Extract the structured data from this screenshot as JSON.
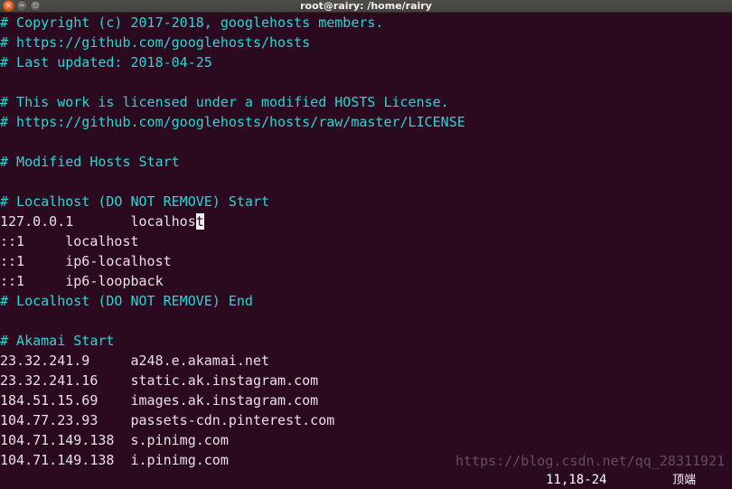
{
  "window": {
    "title": "root@rairy: /home/rairy",
    "controls": [
      {
        "name": "close",
        "glyph": "×"
      },
      {
        "name": "minimize",
        "glyph": "−"
      },
      {
        "name": "maximize",
        "glyph": "□"
      }
    ]
  },
  "colors": {
    "background": "#2b0a1f",
    "comment": "#2ad5d5",
    "text": "#e8e0e8",
    "titlebar": "#484844",
    "cursor": "#f4f0f4",
    "watermark": "#6e5a68"
  },
  "editor": {
    "lines": [
      {
        "type": "comment",
        "text": "# Copyright (c) 2017-2018, googlehosts members."
      },
      {
        "type": "comment",
        "text": "# https://github.com/googlehosts/hosts"
      },
      {
        "type": "comment",
        "text": "# Last updated: 2018-04-25"
      },
      {
        "type": "blank",
        "text": ""
      },
      {
        "type": "comment",
        "text": "# This work is licensed under a modified HOSTS License."
      },
      {
        "type": "comment",
        "text": "# https://github.com/googlehosts/hosts/raw/master/LICENSE"
      },
      {
        "type": "blank",
        "text": ""
      },
      {
        "type": "comment",
        "text": "# Modified Hosts Start"
      },
      {
        "type": "blank",
        "text": ""
      },
      {
        "type": "comment",
        "text": "# Localhost (DO NOT REMOVE) Start"
      },
      {
        "type": "cursorline",
        "before": "127.0.0.1       localhos",
        "cursor": "t",
        "after": ""
      },
      {
        "type": "plain",
        "text": "::1     localhost"
      },
      {
        "type": "plain",
        "text": "::1     ip6-localhost"
      },
      {
        "type": "plain",
        "text": "::1     ip6-loopback"
      },
      {
        "type": "comment",
        "text": "# Localhost (DO NOT REMOVE) End"
      },
      {
        "type": "blank",
        "text": ""
      },
      {
        "type": "comment",
        "text": "# Akamai Start"
      },
      {
        "type": "plain",
        "text": "23.32.241.9     a248.e.akamai.net"
      },
      {
        "type": "plain",
        "text": "23.32.241.16    static.ak.instagram.com"
      },
      {
        "type": "plain",
        "text": "184.51.15.69    images.ak.instagram.com"
      },
      {
        "type": "plain",
        "text": "104.77.23.93    passets-cdn.pinterest.com"
      },
      {
        "type": "plain",
        "text": "104.71.149.138  s.pinimg.com"
      },
      {
        "type": "plain",
        "text": "104.71.149.138  i.pinimg.com"
      }
    ]
  },
  "watermark": {
    "text": "https://blog.csdn.net/qq_28311921"
  },
  "status": {
    "position": "11,18-24",
    "scroll": "顶端"
  }
}
